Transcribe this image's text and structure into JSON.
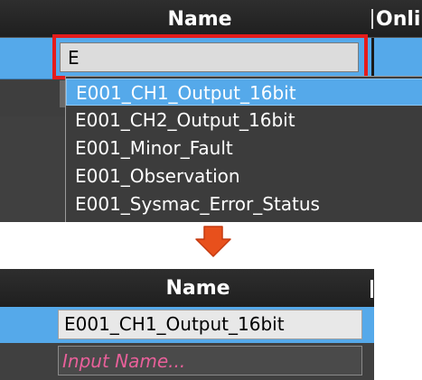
{
  "top": {
    "header": {
      "name": "Name",
      "online": "Onli"
    },
    "edit_value": "E",
    "autocomplete": [
      "E001_CH1_Output_16bit",
      "E001_CH2_Output_16bit",
      "E001_Minor_Fault",
      "E001_Observation",
      "E001_Sysmac_Error_Status"
    ],
    "selected_index": 0
  },
  "bottom": {
    "header": {
      "name": "Name"
    },
    "result_value": "E001_CH1_Output_16bit",
    "new_placeholder": "Input Name..."
  },
  "colors": {
    "highlight_border": "#e41c1c",
    "arrow": "#e8501c",
    "selection": "#55a9ea",
    "placeholder": "#e8609a"
  },
  "icons": {
    "transition": "arrow-down-icon"
  }
}
